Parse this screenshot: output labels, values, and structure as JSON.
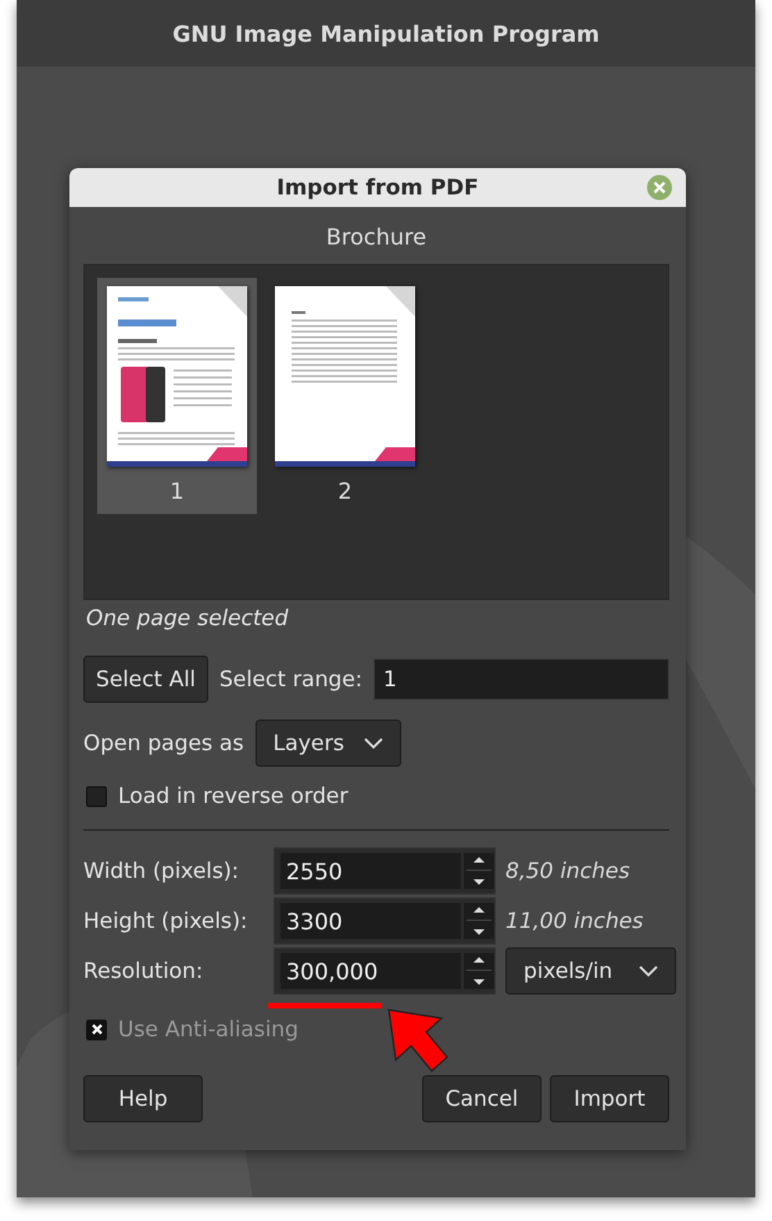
{
  "window": {
    "title": "GNU Image Manipulation Program"
  },
  "dialog": {
    "title": "Import from PDF",
    "document_title": "Brochure",
    "pages": [
      {
        "label": "1",
        "selected": true
      },
      {
        "label": "2",
        "selected": false
      }
    ],
    "selection_status": "One page selected",
    "select_all_button": "Select All",
    "select_range": {
      "label": "Select range:",
      "value": "1"
    },
    "open_pages_as": {
      "label": "Open pages as",
      "value": "Layers"
    },
    "reverse_order": {
      "label": "Load in reverse order",
      "checked": false
    },
    "fields": [
      {
        "label": "Width (pixels):",
        "value": "2550",
        "note": "8,50 inches"
      },
      {
        "label": "Height (pixels):",
        "value": "3300",
        "note": "11,00 inches"
      },
      {
        "label": "Resolution:",
        "value": "300,000",
        "unit": "pixels/in"
      }
    ],
    "antialiasing": {
      "label": "Use Anti-aliasing",
      "checked": true,
      "disabled": true
    },
    "buttons": [
      {
        "label": "Help",
        "kind": "left"
      },
      {
        "label": "Cancel",
        "kind": "right"
      },
      {
        "label": "Import",
        "kind": "right"
      }
    ]
  }
}
